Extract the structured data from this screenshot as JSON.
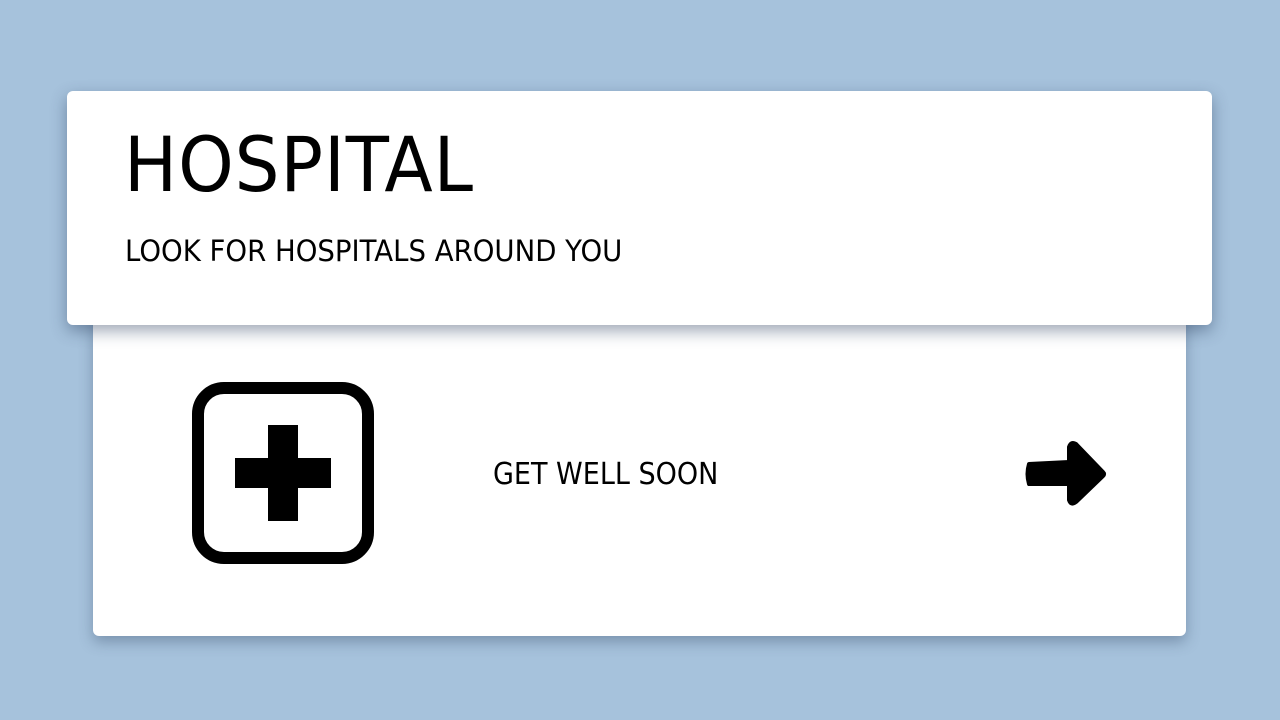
{
  "header": {
    "title": "HOSPITAL",
    "subtitle": "LOOK FOR HOSPITALS AROUND YOU"
  },
  "content": {
    "icon": "hospital-cross-icon",
    "tagline": "GET WELL SOON",
    "action_icon": "arrow-right-icon"
  },
  "colors": {
    "background": "#a6c2dc",
    "card": "#ffffff",
    "text": "#000000"
  }
}
